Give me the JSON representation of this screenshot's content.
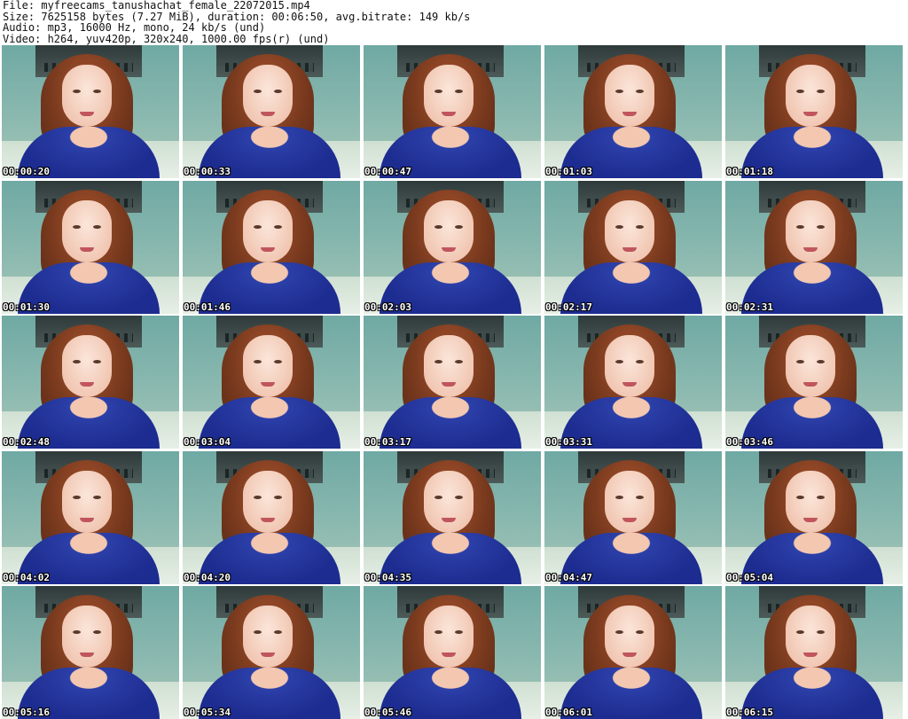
{
  "header": {
    "file_line": "File: myfreecams_tanushachat_female_22072015.mp4",
    "size_line": "Size: 7625158 bytes (7.27 MiB), duration: 00:06:50, avg.bitrate: 149 kb/s",
    "audio_line": "Audio: mp3, 16000 Hz, mono, 24 kb/s (und)",
    "video_line": "Video: h264, yuv420p, 320x240, 1000.00 fps(r) (und)"
  },
  "thumbnails": [
    {
      "timestamp": "00:00:20"
    },
    {
      "timestamp": "00:00:33"
    },
    {
      "timestamp": "00:00:47"
    },
    {
      "timestamp": "00:01:03"
    },
    {
      "timestamp": "00:01:18"
    },
    {
      "timestamp": "00:01:30"
    },
    {
      "timestamp": "00:01:46"
    },
    {
      "timestamp": "00:02:03"
    },
    {
      "timestamp": "00:02:17"
    },
    {
      "timestamp": "00:02:31"
    },
    {
      "timestamp": "00:02:48"
    },
    {
      "timestamp": "00:03:04"
    },
    {
      "timestamp": "00:03:17"
    },
    {
      "timestamp": "00:03:31"
    },
    {
      "timestamp": "00:03:46"
    },
    {
      "timestamp": "00:04:02"
    },
    {
      "timestamp": "00:04:20"
    },
    {
      "timestamp": "00:04:35"
    },
    {
      "timestamp": "00:04:47"
    },
    {
      "timestamp": "00:05:04"
    },
    {
      "timestamp": "00:05:16"
    },
    {
      "timestamp": "00:05:34"
    },
    {
      "timestamp": "00:05:46"
    },
    {
      "timestamp": "00:06:01"
    },
    {
      "timestamp": "00:06:15"
    }
  ]
}
